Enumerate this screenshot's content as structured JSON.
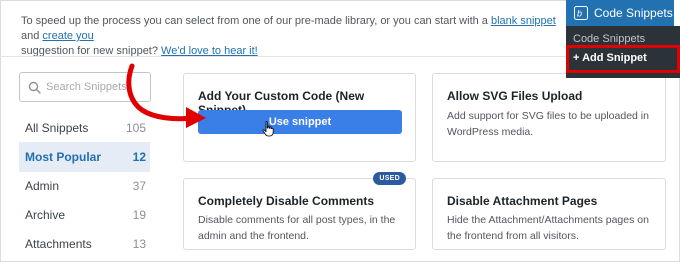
{
  "intro": {
    "text_before": "To speed up the process you can select from one of our pre-made library, or you can start with a ",
    "link_blank": "blank snippet",
    "text_middle": " and ",
    "link_create": "create you",
    "text_second": "suggestion for new snippet? ",
    "link_love": "We'd love to hear it!"
  },
  "search": {
    "placeholder": "Search Snippets"
  },
  "categories": [
    {
      "label": "All Snippets",
      "count": "105"
    },
    {
      "label": "Most Popular",
      "count": "12"
    },
    {
      "label": "Admin",
      "count": "37"
    },
    {
      "label": "Archive",
      "count": "19"
    },
    {
      "label": "Attachments",
      "count": "13"
    }
  ],
  "active_category": "Most Popular",
  "cards": [
    {
      "title": "Add Your Custom Code (New Snippet)",
      "button": "Use snippet"
    },
    {
      "title": "Allow SVG Files Upload",
      "desc": "Add support for SVG files to be uploaded in WordPress media."
    },
    {
      "title": "Completely Disable Comments",
      "desc": "Disable comments for all post types, in the admin and the frontend.",
      "badge": "USED"
    },
    {
      "title": "Disable Attachment Pages",
      "desc": "Hide the Attachment/Attachments pages on the frontend from all visitors."
    }
  ],
  "admin_menu": {
    "title": "Code Snippets",
    "items": [
      "Code Snippets",
      "+ Add Snippet"
    ],
    "active_item": "+ Add Snippet"
  },
  "colors": {
    "primary": "#3a7ee8",
    "admin_dark": "#1d2327",
    "admin_highlight": "#2271b1",
    "annotation_red": "#e00000",
    "badge": "#2c5aa0"
  }
}
